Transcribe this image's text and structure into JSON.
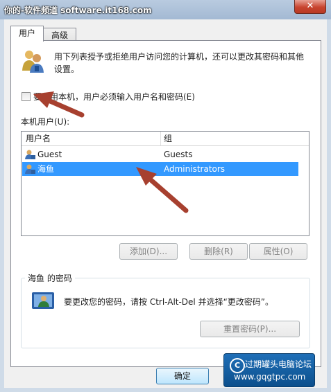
{
  "window": {
    "watermark": "你的-软件频道 software.it168.com",
    "close_glyph": "✕"
  },
  "tabs": [
    {
      "label": "用户"
    },
    {
      "label": "高级"
    }
  ],
  "intro": {
    "text_line1": "用下列表授予或拒绝用户访问您的计算机，还可以更改其密码和其他",
    "text_line2": "设置。"
  },
  "login_option": {
    "label": "要使用本机，用户必须输入用户名和密码(E)",
    "checked": false
  },
  "users_section": {
    "label": "本机用户(U):"
  },
  "user_list": {
    "columns": [
      "用户名",
      "组"
    ],
    "rows": [
      {
        "name": "Guest",
        "group": "Guests",
        "selected": false
      },
      {
        "name": "海鱼",
        "group": "Administrators",
        "selected": true
      }
    ]
  },
  "list_buttons": {
    "add": "添加(D)...",
    "remove": "删除(R)",
    "properties": "属性(O)"
  },
  "password_group": {
    "title": "海鱼 的密码",
    "message": "要更改您的密码，请按 Ctrl-Alt-Del 并选择“更改密码”。",
    "reset_button": "重置密码(P)..."
  },
  "footer": {
    "ok_button": "确定"
  },
  "badge": {
    "title": "过期罐头电脑论坛",
    "url": "www.gqgtpc.com",
    "logo": "C"
  },
  "colors": {
    "arrow": "#a7402f",
    "selection": "#3399ff",
    "titlebar": "#b0c4dc"
  },
  "icons": [
    "users-icon",
    "user-icon",
    "key-user-icon",
    "close-icon"
  ]
}
